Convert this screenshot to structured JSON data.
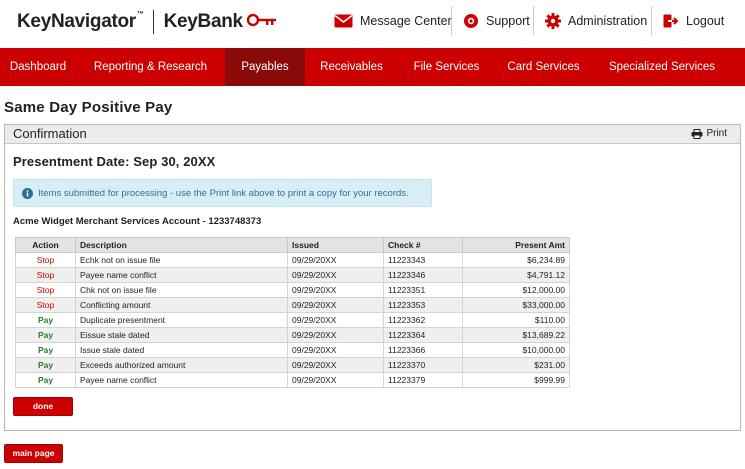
{
  "brand": {
    "product": "KeyNavigator",
    "trademark": "™",
    "bank": "KeyBank"
  },
  "utility": {
    "message_center": "Message Center",
    "support": "Support",
    "administration": "Administration",
    "logout": "Logout"
  },
  "nav": [
    {
      "label": "Dashboard",
      "active": false
    },
    {
      "label": "Reporting & Research",
      "active": false
    },
    {
      "label": "Payables",
      "active": true
    },
    {
      "label": "Receivables",
      "active": false
    },
    {
      "label": "File Services",
      "active": false
    },
    {
      "label": "Card Services",
      "active": false
    },
    {
      "label": "Specialized Services",
      "active": false
    }
  ],
  "page": {
    "title": "Same Day Positive Pay"
  },
  "panel": {
    "title": "Confirmation",
    "print_label": "Print",
    "presentment_date": "Presentment Date: Sep 30, 20XX",
    "info_message": "Items submitted for processing - use the Print link above to print a copy for your records.",
    "account": "Acme Widget Merchant Services Account - 1233748373"
  },
  "table": {
    "headers": {
      "action": "Action",
      "description": "Description",
      "issued": "Issued",
      "check": "Check #",
      "amount": "Present Amt"
    },
    "rows": [
      {
        "action": "Stop",
        "description": "Echk not on issue file",
        "issued": "09/29/20XX",
        "check": "11223343",
        "amount": "$6,234.89"
      },
      {
        "action": "Stop",
        "description": "Payee name conflict",
        "issued": "09/29/20XX",
        "check": "11223346",
        "amount": "$4,791.12"
      },
      {
        "action": "Stop",
        "description": "Chk not on issue file",
        "issued": "09/29/20XX",
        "check": "11223351",
        "amount": "$12,000.00"
      },
      {
        "action": "Stop",
        "description": "Conflicting amount",
        "issued": "09/29/20XX",
        "check": "11223353",
        "amount": "$33,000.00"
      },
      {
        "action": "Pay",
        "description": "Duplicate presentment",
        "issued": "09/29/20XX",
        "check": "11223362",
        "amount": "$110.00"
      },
      {
        "action": "Pay",
        "description": "Eissue stale dated",
        "issued": "09/29/20XX",
        "check": "11223364",
        "amount": "$13,689.22"
      },
      {
        "action": "Pay",
        "description": "Issue stale dated",
        "issued": "09/29/20XX",
        "check": "11223366",
        "amount": "$10,000.00"
      },
      {
        "action": "Pay",
        "description": "Exceeds authorized amount",
        "issued": "09/29/20XX",
        "check": "11223370",
        "amount": "$231.00"
      },
      {
        "action": "Pay",
        "description": "Payee name conflict",
        "issued": "09/29/20XX",
        "check": "11223379",
        "amount": "$999.99"
      }
    ]
  },
  "buttons": {
    "done": "done",
    "main_page": "main page"
  },
  "colors": {
    "brand_red": "#cc0000",
    "nav_active": "#8a0a0a",
    "stop": "#cc0000",
    "pay": "#2d7a2d",
    "info_bg": "#d9edf7"
  }
}
